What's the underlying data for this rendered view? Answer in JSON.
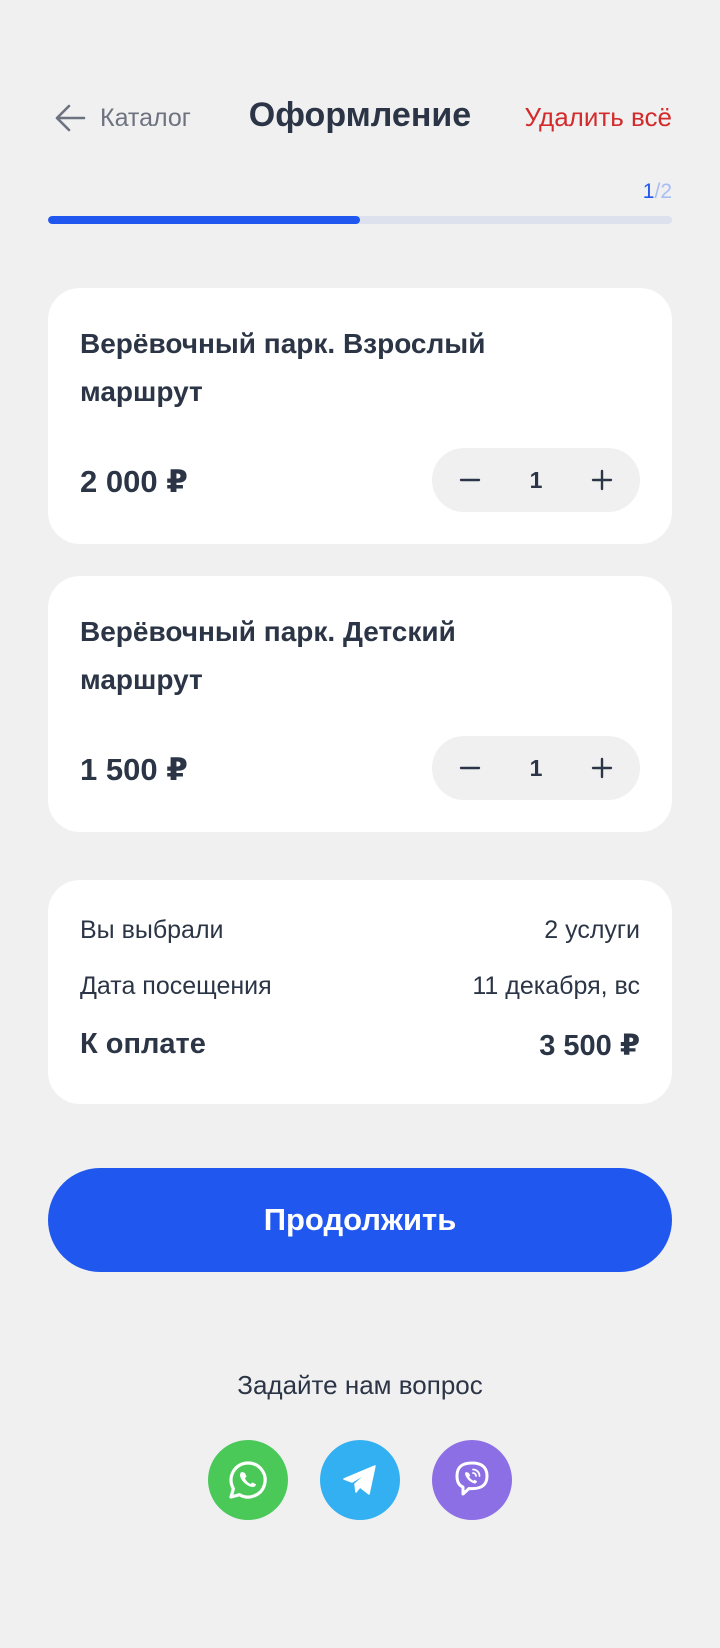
{
  "header": {
    "back_label": "Каталог",
    "title": "Оформление",
    "delete_all_label": "Удалить всё"
  },
  "progress": {
    "current": "1",
    "separator": "/",
    "total": "2",
    "fraction": 0.5,
    "color_active": "#2057ef",
    "color_track": "#dde1ee"
  },
  "items": [
    {
      "name": "Верёвочный парк. Взрослый маршрут",
      "price": "2 000 ₽",
      "quantity": "1"
    },
    {
      "name": "Верёвочный парк. Детский маршрут",
      "price": "1 500 ₽",
      "quantity": "1"
    }
  ],
  "summary": {
    "selected_label": "Вы выбрали",
    "selected_value": "2 услуги",
    "date_label": "Дата посещения",
    "date_value": "11 декабря, вс",
    "total_label": "К оплате",
    "total_value": "3 500 ₽"
  },
  "continue_label": "Продолжить",
  "ask_label": "Задайте нам вопрос",
  "socials": [
    {
      "icon": "whatsapp-icon",
      "color": "#4ac959"
    },
    {
      "icon": "telegram-icon",
      "color": "#33b0f1"
    },
    {
      "icon": "viber-icon",
      "color": "#8c6fe4"
    }
  ],
  "colors": {
    "accent": "#2057ef",
    "danger": "#d32b2b",
    "background": "#f0f0f1"
  }
}
